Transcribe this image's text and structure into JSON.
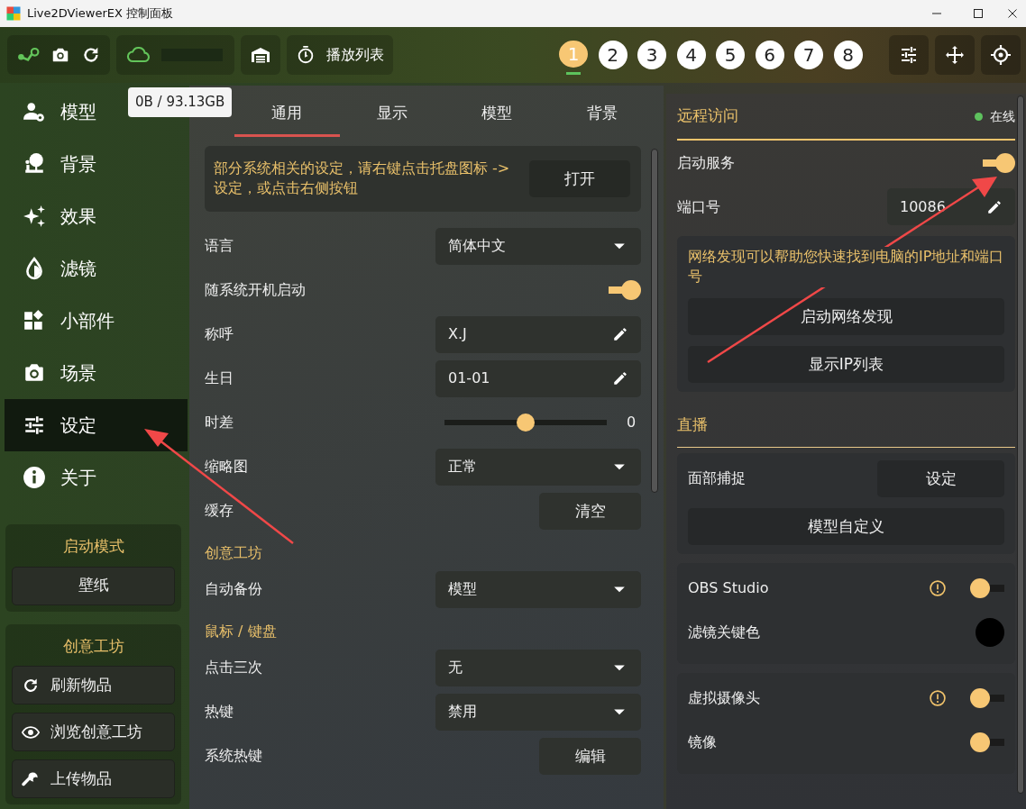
{
  "window": {
    "title": "Live2DViewerEX 控制面板"
  },
  "toolbar": {
    "storage_tooltip": "0B / 93.13GB",
    "playlist_label": "播放列表",
    "slots": [
      {
        "label": "1",
        "selected": true
      },
      {
        "label": "2",
        "selected": false
      },
      {
        "label": "3",
        "selected": false
      },
      {
        "label": "4",
        "selected": false
      },
      {
        "label": "5",
        "selected": false
      },
      {
        "label": "6",
        "selected": false
      },
      {
        "label": "7",
        "selected": false
      },
      {
        "label": "8",
        "selected": false
      }
    ]
  },
  "sidebar": {
    "items": [
      {
        "label": "模型",
        "selected": false
      },
      {
        "label": "背景",
        "selected": false
      },
      {
        "label": "效果",
        "selected": false
      },
      {
        "label": "滤镜",
        "selected": false
      },
      {
        "label": "小部件",
        "selected": false
      },
      {
        "label": "场景",
        "selected": false
      },
      {
        "label": "设定",
        "selected": true
      },
      {
        "label": "关于",
        "selected": false
      }
    ],
    "sections": [
      {
        "title": "启动模式",
        "buttons": [
          "壁纸"
        ]
      },
      {
        "title": "创意工坊",
        "buttons": [
          "刷新物品",
          "浏览创意工坊",
          "上传物品"
        ]
      }
    ]
  },
  "settings": {
    "tabs": [
      {
        "label": "通用",
        "selected": true
      },
      {
        "label": "显示",
        "selected": false
      },
      {
        "label": "模型",
        "selected": false
      },
      {
        "label": "背景",
        "selected": false
      }
    ],
    "notice": {
      "text": "部分系统相关的设定，请右键点击托盘图标 -> 设定，或点击右侧按钮",
      "button": "打开"
    },
    "rows": [
      {
        "kind": "select",
        "label": "语言",
        "value": "简体中文"
      },
      {
        "kind": "toggle",
        "label": "随系统开机启动",
        "on": true
      },
      {
        "kind": "edit",
        "label": "称呼",
        "value": "X.J"
      },
      {
        "kind": "edit",
        "label": "生日",
        "value": "01-01"
      },
      {
        "kind": "slider",
        "label": "时差",
        "level": 0.5,
        "reading": "0"
      },
      {
        "kind": "select",
        "label": "缩略图",
        "value": "正常"
      },
      {
        "kind": "button",
        "label": "缓存",
        "button": "清空"
      },
      {
        "kind": "heading",
        "label": "创意工坊"
      },
      {
        "kind": "select",
        "label": "自动备份",
        "value": "模型"
      },
      {
        "kind": "heading",
        "label": "鼠标 / 键盘"
      },
      {
        "kind": "select",
        "label": "点击三次",
        "value": "无"
      },
      {
        "kind": "select",
        "label": "热键",
        "value": "禁用"
      },
      {
        "kind": "button",
        "label": "系统热键",
        "button": "编辑"
      }
    ]
  },
  "remote": {
    "title": "远程访问",
    "status": {
      "label": "在线",
      "color": "#5ec25e"
    },
    "rows": [
      {
        "kind": "toggle",
        "label": "启动服务",
        "on": true
      },
      {
        "kind": "edit",
        "label": "端口号",
        "value": "10086"
      }
    ],
    "discovery": {
      "text": "网络发现可以帮助您快速找到电脑的IP地址和端口号",
      "buttons": [
        "启动网络发现",
        "显示IP列表"
      ]
    }
  },
  "live": {
    "title": "直播",
    "groups": [
      [
        {
          "kind": "button",
          "label": "面部捕捉",
          "button": "设定"
        },
        {
          "kind": "wide-button",
          "button": "模型自定义"
        }
      ],
      [
        {
          "kind": "toggle",
          "label": "OBS Studio",
          "on": false,
          "warning": true
        },
        {
          "kind": "color",
          "label": "滤镜关键色",
          "color": "#000000"
        }
      ],
      [
        {
          "kind": "toggle",
          "label": "虚拟摄像头",
          "on": false,
          "warning": true
        },
        {
          "kind": "toggle",
          "label": "镜像",
          "on": false,
          "warning": false
        }
      ]
    ]
  }
}
